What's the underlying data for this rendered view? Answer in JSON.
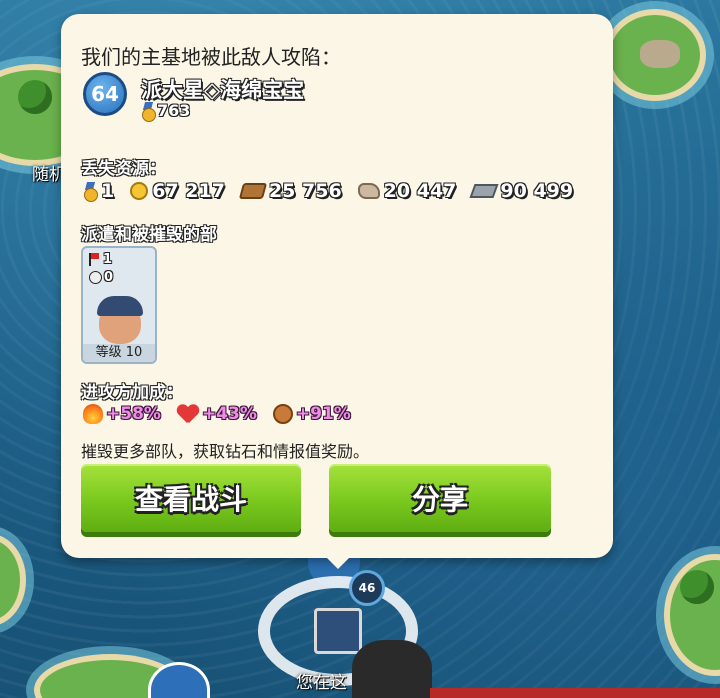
{
  "panel": {
    "title": "我们的主基地被此敌人攻陷：",
    "attacker": {
      "level": "64",
      "name": "派大星◇海绵宝宝",
      "trophies": "763"
    },
    "lost_label": "丢失资源：",
    "lost_resources": [
      {
        "icon": "medal-icon",
        "value": "1"
      },
      {
        "icon": "gold-icon",
        "value": "67 217"
      },
      {
        "icon": "wood-icon",
        "value": "25 756"
      },
      {
        "icon": "stone-icon",
        "value": "20 447"
      },
      {
        "icon": "iron-icon",
        "value": "90 499"
      }
    ],
    "units_label": "派遣和被摧毁的部",
    "unit": {
      "deployed": "1",
      "destroyed": "0",
      "level_label": "等级 10"
    },
    "boost_label": "进攻方加成：",
    "boosts": [
      {
        "icon": "fire-icon",
        "value": "+58%"
      },
      {
        "icon": "heart-icon",
        "value": "+43%"
      },
      {
        "icon": "damage-icon",
        "value": "+91%"
      }
    ],
    "hint": "摧毁更多部队，获取钻石和情报值奖励。",
    "btn_view_battle": "查看战斗",
    "btn_share": "分享"
  },
  "map": {
    "left_label": "随机",
    "base_level": "46",
    "you_are_here": "您在这"
  },
  "colors": {
    "panel_bg": "#fbf6e6",
    "button_green": "#79c81e",
    "boost_pink": "#f08ae6"
  }
}
